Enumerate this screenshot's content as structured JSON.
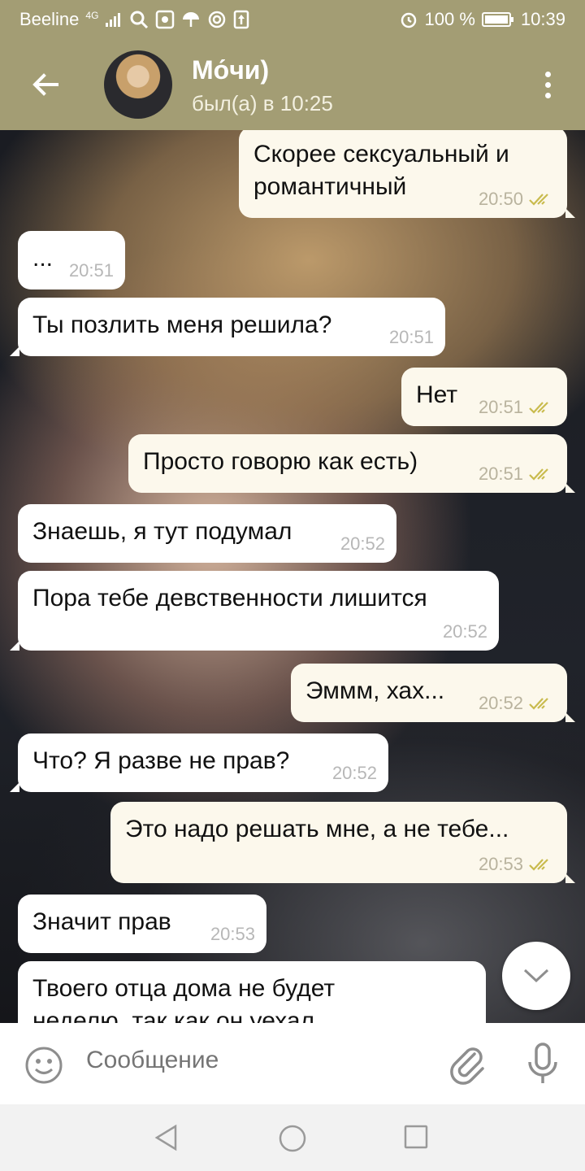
{
  "status_bar": {
    "carrier": "Beeline",
    "network": "4G",
    "battery": "100 %",
    "time": "10:39"
  },
  "header": {
    "title": "Мо́чи)",
    "subtitle": "был(а) в 10:25"
  },
  "messages": [
    {
      "dir": "out",
      "text": "Скорее сексуальный и\nромантичный",
      "time": "20:50",
      "read": true
    },
    {
      "dir": "in",
      "text": "...",
      "time": "20:51"
    },
    {
      "dir": "in",
      "text": "Ты позлить меня решила?",
      "time": "20:51"
    },
    {
      "dir": "out",
      "text": "Нет",
      "time": "20:51",
      "read": true
    },
    {
      "dir": "out",
      "text": "Просто говорю как есть)",
      "time": "20:51",
      "read": true
    },
    {
      "dir": "in",
      "text": "Знаешь, я тут подумал",
      "time": "20:52"
    },
    {
      "dir": "in",
      "text": "Пора тебе девственности лишится",
      "time": "20:52"
    },
    {
      "dir": "out",
      "text": "Эммм, хах...",
      "time": "20:52",
      "read": true
    },
    {
      "dir": "in",
      "text": "Что? Я разве не прав?",
      "time": "20:52"
    },
    {
      "dir": "out",
      "text": "Это надо решать мне, а не тебе...",
      "time": "20:53",
      "read": true
    },
    {
      "dir": "in",
      "text": "Значит прав",
      "time": "20:53"
    },
    {
      "dir": "in",
      "text": "Твоего отца дома не будет\nнеделю, так как он уехал",
      "time": ""
    }
  ],
  "composer": {
    "placeholder": "Сообщение"
  },
  "colors": {
    "header_bg": "#a39d74",
    "incoming_bubble": "#ffffff",
    "outgoing_bubble": "#fcf8ec",
    "read_check": "#c9bb4e"
  },
  "icons": {
    "back": "arrow-left-icon",
    "menu": "more-vertical-icon",
    "scroll_down": "chevron-down-icon",
    "emoji": "smile-icon",
    "attach": "paperclip-icon",
    "mic": "microphone-icon"
  }
}
